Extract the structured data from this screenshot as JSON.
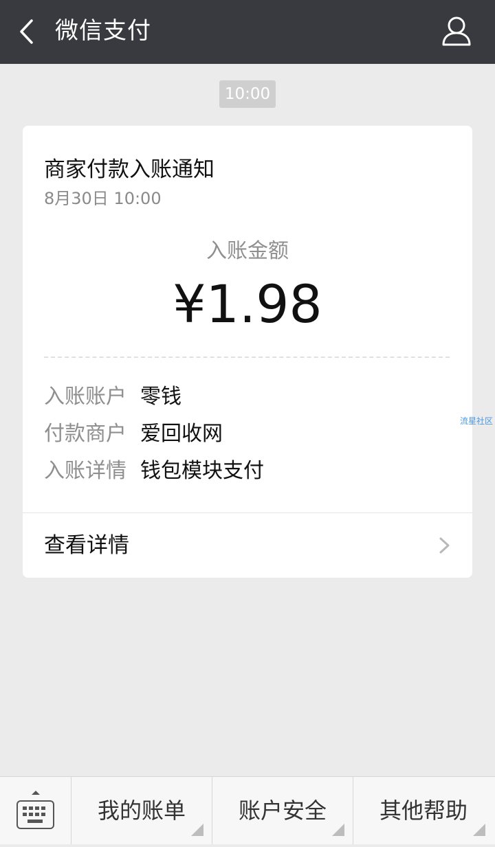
{
  "header": {
    "title": "微信支付",
    "back_icon": "chevron-left-icon",
    "profile_icon": "person-icon"
  },
  "timestamp": "10:00",
  "card": {
    "title": "商家付款入账通知",
    "date": "8月30日  10:00",
    "amount_label": "入账金额",
    "amount": "¥1.98",
    "rows": [
      {
        "label": "入账账户",
        "value": "零钱"
      },
      {
        "label": "付款商户",
        "value": "爱回收网"
      },
      {
        "label": "入账详情",
        "value": "钱包模块支付"
      }
    ],
    "detail_link": "查看详情"
  },
  "watermark": "流星社区",
  "bottom_menu": {
    "keyboard_icon": "keyboard-icon",
    "items": [
      {
        "label": "我的账单"
      },
      {
        "label": "账户安全"
      },
      {
        "label": "其他帮助"
      }
    ]
  },
  "colors": {
    "header_bg": "#393a3f",
    "page_bg": "#ebebeb",
    "card_bg": "#ffffff"
  }
}
